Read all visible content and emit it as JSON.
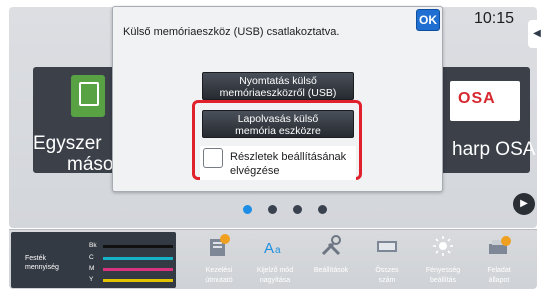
{
  "clock": "10:15",
  "tiles": {
    "left": {
      "line1": "Egyszer",
      "line2": "másolás"
    },
    "right": {
      "logo": "OSA",
      "line1": "harp OSA"
    }
  },
  "dialog": {
    "message": "Külső memóriaeszköz (USB) csatlakoztatva.",
    "ok_label": "OK",
    "print_button": {
      "line1": "Nyomtatás külső",
      "line2": "memóriaeszközről (USB)"
    },
    "scan_button": {
      "line1": "Lapolvasás külső",
      "line2": "memória eszközre"
    },
    "checkbox": {
      "line1": "Részletek beállításának",
      "line2": "elvégzése",
      "checked": false
    }
  },
  "pager": {
    "pages": 4,
    "active": 0
  },
  "toolbar": {
    "toner": {
      "label_line1": "Festék",
      "label_line2": "mennyiség",
      "rows": [
        {
          "name": "Bk",
          "color": "#111111"
        },
        {
          "name": "C",
          "color": "#16b3c8"
        },
        {
          "name": "M",
          "color": "#d9337f"
        },
        {
          "name": "Y",
          "color": "#e3c300"
        }
      ]
    },
    "items": [
      {
        "line1": "Kezelési",
        "line2": "útmutató",
        "icon": "manual-icon"
      },
      {
        "line1": "Kijelző mód",
        "line2": "nagyítása",
        "icon": "display-zoom-icon"
      },
      {
        "line1": "Beállítások",
        "line2": "",
        "icon": "settings-icon"
      },
      {
        "line1": "Összes",
        "line2": "szám",
        "icon": "counter-icon"
      },
      {
        "line1": "Fényesség",
        "line2": "beállítás",
        "icon": "brightness-icon"
      },
      {
        "line1": "Feladat",
        "line2": "állapot",
        "icon": "job-status-icon"
      }
    ]
  },
  "colors": {
    "highlight": "#e0202a",
    "ok": "#1e6fd1",
    "active_dot": "#1d8de6"
  }
}
